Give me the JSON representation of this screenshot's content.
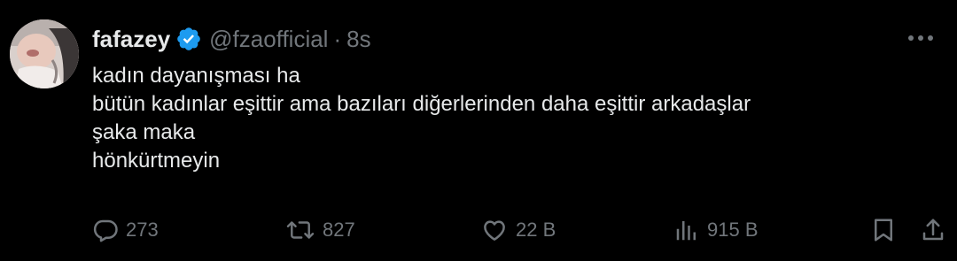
{
  "author": {
    "display_name": "fafazey",
    "handle": "@fzaofficial",
    "separator": "·",
    "time": "8s",
    "verified": true
  },
  "tweet": {
    "lines": [
      "kadın dayanışması ha",
      "bütün kadınlar eşittir ama bazıları diğerlerinden daha eşittir arkadaşlar",
      "şaka maka",
      "hönkürtmeyin"
    ]
  },
  "actions": {
    "replies": "273",
    "reposts": "827",
    "likes": "22 B",
    "views": "915 B"
  },
  "icons": {
    "more": "more-horizontal-icon",
    "reply": "reply-icon",
    "repost": "repost-icon",
    "like": "heart-icon",
    "views": "views-icon",
    "bookmark": "bookmark-icon",
    "share": "share-icon",
    "verified": "verified-badge-icon"
  },
  "colors": {
    "background": "#000000",
    "text": "#e7e9ea",
    "secondary": "#71767b",
    "verified": "#1d9bf0"
  }
}
